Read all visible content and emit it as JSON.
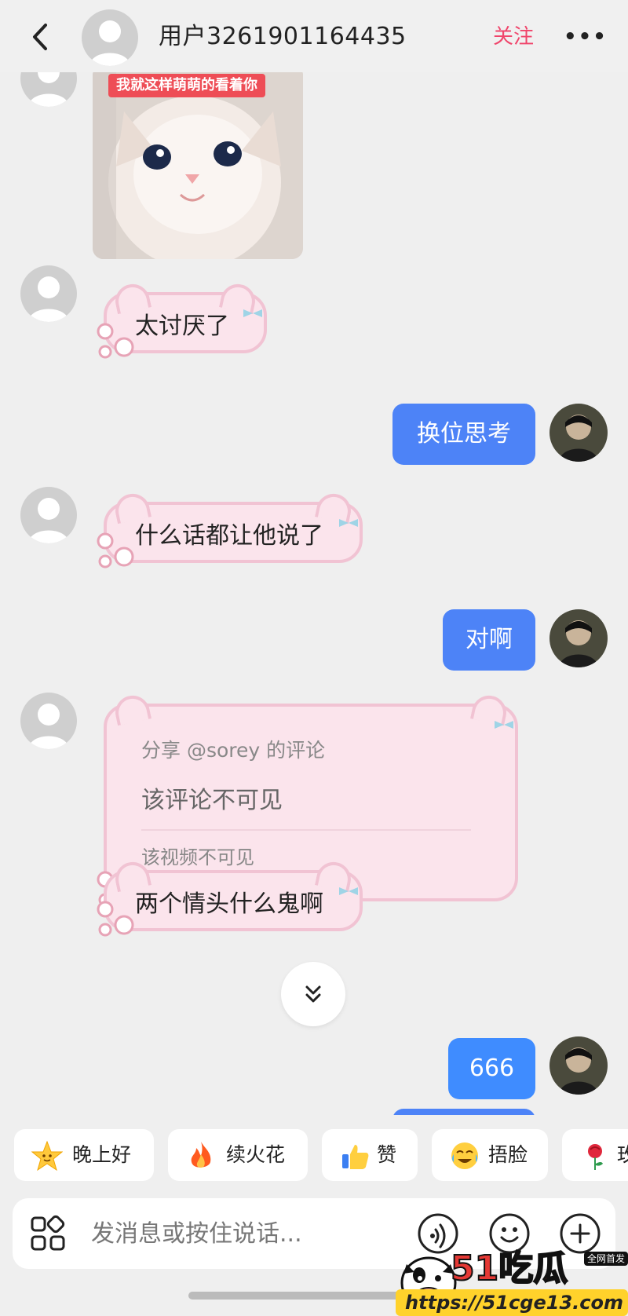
{
  "header": {
    "back_icon": "chevron-left-icon",
    "username": "用户3261901164435",
    "follow_label": "关注",
    "more_label": "•••"
  },
  "chat": {
    "image_caption": "我就这样萌萌的看着你",
    "messages": [
      {
        "side": "received",
        "text": "太讨厌了"
      },
      {
        "side": "sent",
        "text": "换位思考"
      },
      {
        "side": "received",
        "text": "什么话都让他说了"
      },
      {
        "side": "sent",
        "text": "对啊"
      },
      {
        "side": "received",
        "share": {
          "title": "分享 @sorey 的评论",
          "comment": "该评论不可见",
          "video": "该视频不可见"
        }
      },
      {
        "side": "received",
        "text": "两个情头什么鬼啊"
      },
      {
        "side": "sent",
        "text": "666"
      }
    ]
  },
  "quick_replies": [
    {
      "emoji": "star-face-icon",
      "label": "晚上好"
    },
    {
      "emoji": "fire-icon",
      "label": "续火花"
    },
    {
      "emoji": "thumbs-up-icon",
      "label": "赞"
    },
    {
      "emoji": "face-with-tears-icon",
      "label": "捂脸"
    },
    {
      "emoji": "rose-icon",
      "label": "玫"
    }
  ],
  "input": {
    "placeholder": "发消息或按住说话..."
  },
  "watermark": {
    "brand": "51吃瓜",
    "badge": "全网首发",
    "url": "https://51cge13.com"
  },
  "colors": {
    "accent_blue": "#4d83f7",
    "follow_red": "#f0456b",
    "pink_bubble": "#fbe4ec"
  }
}
